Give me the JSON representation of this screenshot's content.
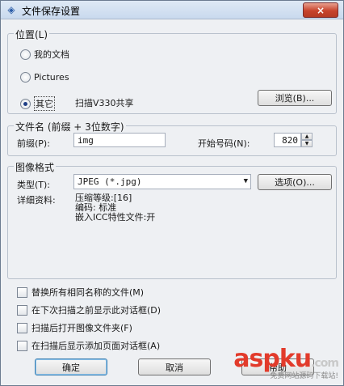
{
  "window": {
    "title": "文件保存设置",
    "close_label": "×"
  },
  "location": {
    "legend": "位置(L)",
    "options": [
      {
        "label": "我的文档",
        "selected": false
      },
      {
        "label": "Pictures",
        "selected": false
      },
      {
        "label": "其它",
        "selected": true
      }
    ],
    "other_path": "扫描V330共享",
    "browse_label": "浏览(B)..."
  },
  "filename": {
    "legend": "文件名 (前缀 + 3位数字)",
    "prefix_label": "前缀(P):",
    "prefix_value": "img",
    "start_label": "开始号码(N):",
    "start_value": "820"
  },
  "image_format": {
    "legend": "图像格式",
    "type_label": "类型(T):",
    "type_value": "JPEG (*.jpg)",
    "options_label": "选项(O)...",
    "details_label": "详细资料:",
    "details_lines": [
      "压缩等级:[16]",
      "编码: 标准",
      "嵌入ICC特性文件:开"
    ]
  },
  "checkboxes": [
    "替换所有相同名称的文件(M)",
    "在下次扫描之前显示此对话框(D)",
    "扫描后打开图像文件夹(F)",
    "在扫描后显示添加页面对话框(A)"
  ],
  "buttons": {
    "ok": "确定",
    "cancel": "取消",
    "help": "帮助"
  },
  "watermark": {
    "logo_a": "asp",
    "logo_b": "ku",
    "logo_c": ".com",
    "tagline": "免费网站源码下载站!"
  }
}
